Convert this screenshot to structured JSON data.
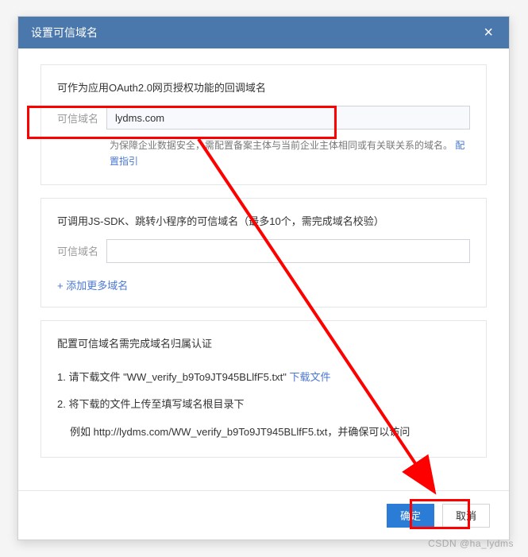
{
  "modal": {
    "title": "设置可信域名",
    "close_label": "×"
  },
  "section1": {
    "title": "可作为应用OAuth2.0网页授权功能的回调域名",
    "field_label": "可信域名",
    "field_value": "lydms.com",
    "help_prefix": "为保障企业数据安全，需配置备案主体与当前企业主体相同或有关联关系的域名。",
    "help_link": "配置指引"
  },
  "section2": {
    "title": "可调用JS-SDK、跳转小程序的可信域名（最多10个，需完成域名校验）",
    "field_label": "可信域名",
    "field_value": "",
    "add_link": "+ 添加更多域名"
  },
  "section3": {
    "title": "配置可信域名需完成域名归属认证",
    "step1_prefix": "1. 请下载文件 \"WW_verify_b9To9JT945BLlfF5.txt\"  ",
    "step1_link": "下载文件",
    "step2": "2. 将下载的文件上传至填写域名根目录下",
    "step2_sub": "例如 http://lydms.com/WW_verify_b9To9JT945BLlfF5.txt，并确保可以访问"
  },
  "footer": {
    "confirm": "确定",
    "cancel": "取消"
  },
  "watermark": "CSDN @ha_lydms"
}
